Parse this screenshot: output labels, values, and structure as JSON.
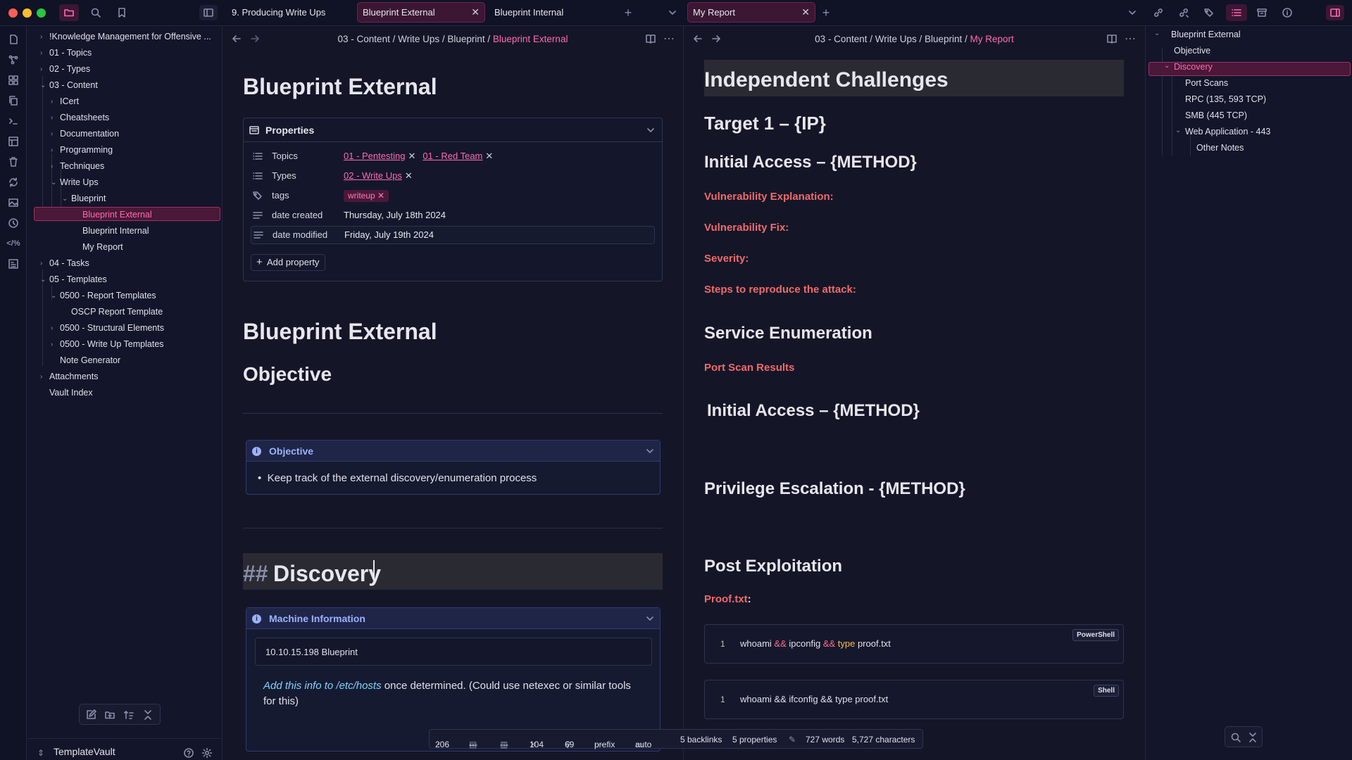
{
  "colors": {
    "accent": "#ff6ab0",
    "selected_bg": "#4a1838",
    "callout_title": "#9cb2ff",
    "section_red": "#f06a6a",
    "background": "#13152a"
  },
  "tabs": [
    {
      "label": "9. Producing Write Ups"
    },
    {
      "label": "Blueprint External"
    },
    {
      "label": "Blueprint Internal"
    },
    {
      "label": "My Report"
    }
  ],
  "sidebar": {
    "items": [
      {
        "label": "!Knowledge Management for Offensive ..."
      },
      {
        "label": "01 - Topics"
      },
      {
        "label": "02 - Types"
      },
      {
        "label": "03 - Content"
      },
      {
        "label": "ICert"
      },
      {
        "label": "Cheatsheets"
      },
      {
        "label": "Documentation"
      },
      {
        "label": "Programming"
      },
      {
        "label": "Techniques"
      },
      {
        "label": "Write Ups"
      },
      {
        "label": "Blueprint"
      },
      {
        "label": "Blueprint External"
      },
      {
        "label": "Blueprint Internal"
      },
      {
        "label": "My Report"
      },
      {
        "label": "04 - Tasks"
      },
      {
        "label": "05 - Templates"
      },
      {
        "label": "0500 - Report Templates"
      },
      {
        "label": "OSCP Report Template"
      },
      {
        "label": "0500 - Structural Elements"
      },
      {
        "label": "0500 - Write Up Templates"
      },
      {
        "label": "Note Generator"
      },
      {
        "label": "Attachments"
      },
      {
        "label": "Vault Index"
      }
    ],
    "vault_name": "TemplateVault"
  },
  "left_pane": {
    "crumb_prefix": "03 - Content / Write Ups / Blueprint /",
    "crumb_current": "Blueprint External",
    "title": "Blueprint External",
    "properties": {
      "header": "Properties",
      "topics_key": "Topics",
      "topics": [
        "01 - Pentesting",
        "01 - Red Team"
      ],
      "types_key": "Types",
      "types": [
        "02 - Write Ups"
      ],
      "tags_key": "tags",
      "tags": [
        "writeup"
      ],
      "created_key": "date created",
      "created": "Thursday, July 18th 2024",
      "modified_key": "date modified",
      "modified": "Friday, July 19th 2024",
      "add": "Add property"
    },
    "heading1": "Blueprint External",
    "heading2": "Objective",
    "objective_callout": {
      "title": "Objective",
      "bullet": "Keep track of the external discovery/enumeration process"
    },
    "discovery_prefix": "##",
    "discovery": "Discovery",
    "machine_callout": {
      "title": "Machine Information",
      "code": "10.10.15.198 Blueprint",
      "note_link": "Add this info to /etc/hosts",
      "note_rest": " once determined. (Could use netexec or similar tools for this)"
    }
  },
  "right_pane": {
    "crumb_prefix": "03 - Content / Write Ups / Blueprint /",
    "crumb_current": "My Report",
    "h_independent": "Independent Challenges",
    "h_target": "Target 1 – {IP}",
    "h_initial": "Initial Access – {METHOD}",
    "vuln_expl": "Vulnerability Explanation:",
    "vuln_fix": "Vulnerability Fix:",
    "severity": "Severity:",
    "steps": "Steps to reproduce the attack:",
    "h_service": "Service Enumeration",
    "port_scan": "Port Scan Results",
    "h_initial2": "Initial Access – {METHOD}",
    "h_privesc": "Privilege Escalation - {METHOD}",
    "h_post": "Post Exploitation",
    "proof": "Proof.txt",
    "proof_colon": ":",
    "code1": {
      "line": "1",
      "lang": "PowerShell",
      "a": "whoami ",
      "op1": "&&",
      "b": " ipconfig ",
      "op2": "&&",
      "kw": " type",
      "c": " proof.txt"
    },
    "code2": {
      "line": "1",
      "lang": "Shell",
      "text": "whoami && ifconfig && type proof.txt"
    }
  },
  "outline": {
    "items": [
      "Blueprint External",
      "Objective",
      "Discovery",
      "Port Scans",
      "RPC (135, 593 TCP)",
      "SMB (445 TCP)",
      "Web Application - 443",
      "Other Notes"
    ]
  },
  "status": {
    "s1": "206",
    "s2": "---",
    "s3": "---",
    "s4": "104",
    "s5": "69",
    "s6": "prefix",
    "s7": "auto",
    "backlinks": "5 backlinks",
    "properties": "5 properties",
    "words": "727 words",
    "chars": "5,727 characters"
  }
}
